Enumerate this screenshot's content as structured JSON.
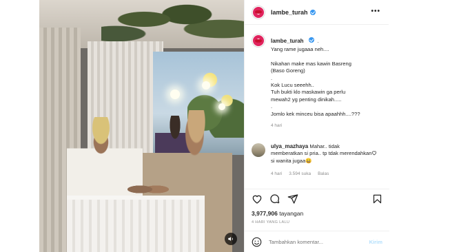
{
  "post": {
    "username": "lambe_turah",
    "caption_dot": ".",
    "caption": "Yang rame jugaaa neh....\n\nNikahan make mas kawin Basreng\n(Baso Goreng)\n.\nKok Lucu seeehh..\nTuh bukti klo maskawin ga perlu\nmewah2 yg penting dinikah.....\n.\nJomlo kek minceu bisa apaahhh....???",
    "caption_time": "4 hari"
  },
  "comment": {
    "username": "ulya_mazhaya",
    "text": "Mahar.. tidak memberatkan si pria.. tp tdak merendahkan si wanita jugaa😄",
    "time": "4 hari",
    "likes": "3.594 suka",
    "reply": "Balas"
  },
  "stats": {
    "views_count": "3,977,906",
    "views_label": "tayangan",
    "date": "4 HARI YANG LALU"
  },
  "composer": {
    "placeholder": "Tambahkan komentar...",
    "post_label": "Kirim"
  },
  "icons": {
    "more": "more-options-icon",
    "heart": "heart-icon",
    "comment": "comment-icon",
    "share": "share-icon",
    "bookmark": "bookmark-icon",
    "emoji": "emoji-icon",
    "mute": "volume-icon",
    "verified": "verified-badge-icon"
  },
  "colors": {
    "verified_blue": "#3897f0",
    "link_disabled": "#b2dffc",
    "muted_text": "#8e8e8e"
  }
}
